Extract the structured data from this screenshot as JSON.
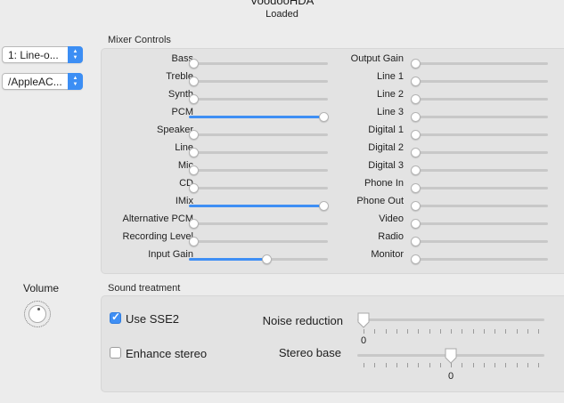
{
  "header": {
    "title": "VoodooHDA",
    "status": "Loaded"
  },
  "popups": [
    {
      "value": "1: Line-o..."
    },
    {
      "value": "/AppleAC..."
    }
  ],
  "mixer": {
    "title": "Mixer Controls",
    "left": [
      {
        "label": "Bass",
        "value": 0
      },
      {
        "label": "Treble",
        "value": 0
      },
      {
        "label": "Synth",
        "value": 0
      },
      {
        "label": "PCM",
        "value": 100
      },
      {
        "label": "Speaker",
        "value": 0
      },
      {
        "label": "Line",
        "value": 0
      },
      {
        "label": "Mic",
        "value": 0
      },
      {
        "label": "CD",
        "value": 0
      },
      {
        "label": "IMix",
        "value": 100
      },
      {
        "label": "Alternative PCM",
        "value": 0
      },
      {
        "label": "Recording Level",
        "value": 0
      },
      {
        "label": "Input Gain",
        "value": 56
      }
    ],
    "right": [
      {
        "label": "Output Gain",
        "value": 0
      },
      {
        "label": "Line 1",
        "value": 0
      },
      {
        "label": "Line 2",
        "value": 0
      },
      {
        "label": "Line 3",
        "value": 0
      },
      {
        "label": "Digital 1",
        "value": 0
      },
      {
        "label": "Digital 2",
        "value": 0
      },
      {
        "label": "Digital 3",
        "value": 0
      },
      {
        "label": "Phone In",
        "value": 0
      },
      {
        "label": "Phone Out",
        "value": 0
      },
      {
        "label": "Video",
        "value": 0
      },
      {
        "label": "Radio",
        "value": 0
      },
      {
        "label": "Monitor",
        "value": 0
      }
    ]
  },
  "volume": {
    "label": "Volume"
  },
  "sound": {
    "title": "Sound treatment",
    "use_sse2": {
      "label": "Use SSE2",
      "checked": true
    },
    "enhance_stereo": {
      "label": "Enhance stereo",
      "checked": false
    },
    "noise_reduction": {
      "label": "Noise reduction",
      "value": "0",
      "level": 0
    },
    "stereo_base": {
      "label": "Stereo base",
      "value": "0",
      "level": 50
    }
  },
  "colors": {
    "accent": "#3f8ff4",
    "window_bg": "#ececec",
    "group_bg": "#e3e3e3"
  }
}
